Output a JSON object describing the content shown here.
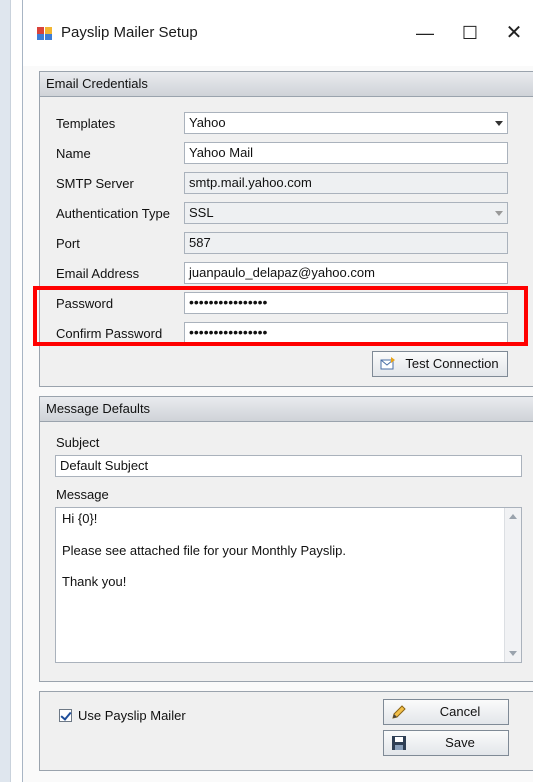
{
  "window": {
    "title": "Payslip Mailer Setup",
    "minimize_glyph": "—",
    "maximize_glyph": "☐",
    "close_glyph": "✕"
  },
  "email_credentials": {
    "header": "Email Credentials",
    "templates": {
      "label": "Templates",
      "value": "Yahoo"
    },
    "name": {
      "label": "Name",
      "value": "Yahoo Mail"
    },
    "smtp_server": {
      "label": "SMTP Server",
      "value": "smtp.mail.yahoo.com"
    },
    "authentication_type": {
      "label": "Authentication Type",
      "value": "SSL"
    },
    "port": {
      "label": "Port",
      "value": "587"
    },
    "email_address": {
      "label": "Email Address",
      "value": "juanpaulo_delapaz@yahoo.com"
    },
    "password": {
      "label": "Password",
      "value": "••••••••••••••••"
    },
    "confirm_password": {
      "label": "Confirm Password",
      "value": "••••••••••••••••"
    },
    "test_connection_label": "Test Connection"
  },
  "message_defaults": {
    "header": "Message Defaults",
    "subject_label": "Subject",
    "subject_value": "Default Subject",
    "message_label": "Message",
    "message_lines": [
      "Hi {0}!",
      "Please see attached file for your Monthly Payslip.",
      "Thank you!"
    ]
  },
  "footer": {
    "use_payslip_mailer_label": "Use Payslip Mailer",
    "use_payslip_mailer_checked": true,
    "cancel_label": "Cancel",
    "save_label": "Save"
  },
  "colors": {
    "highlight_border": "#ff0000",
    "group_header": "#d9dce0"
  },
  "icons": [
    "app-icon",
    "test-connection-icon",
    "cancel-pencil-icon",
    "save-floppy-icon"
  ]
}
